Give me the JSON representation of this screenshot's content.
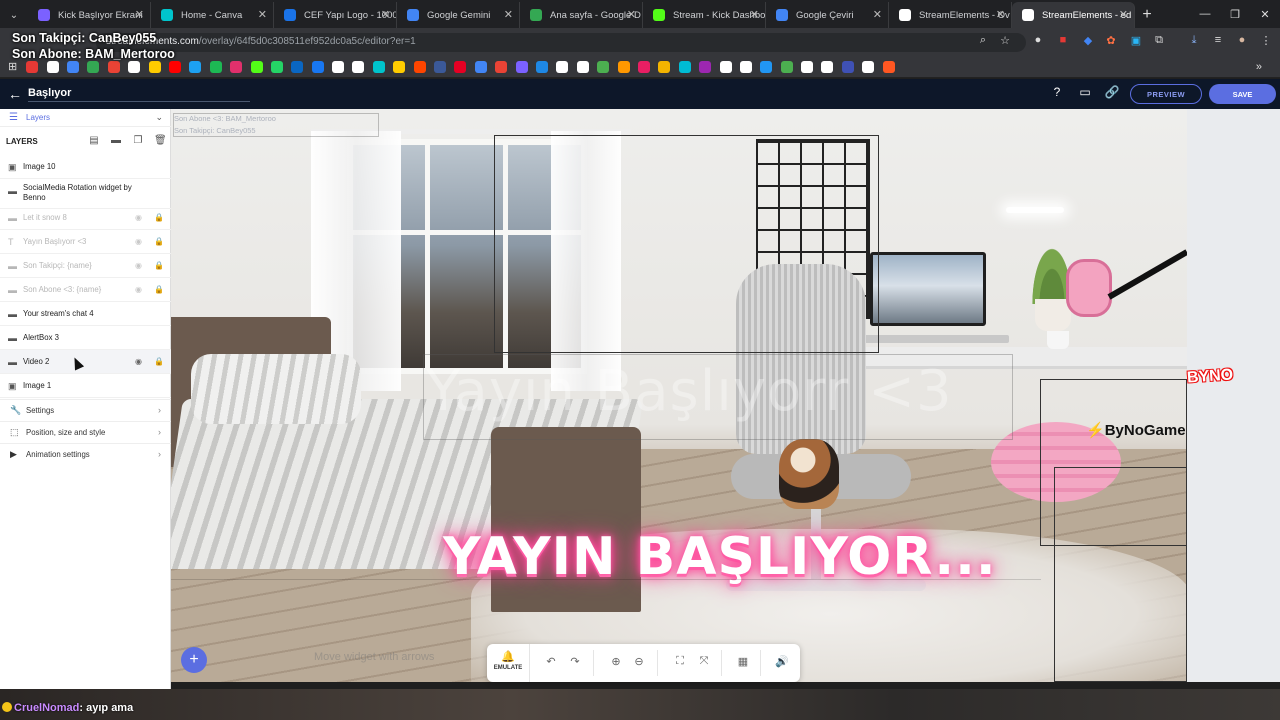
{
  "browser": {
    "tabs": [
      {
        "title": "Kick Başlıyor Ekranı",
        "color": "#7b61ff",
        "active": false
      },
      {
        "title": "Home - Canva",
        "color": "#00c4cc",
        "active": false
      },
      {
        "title": "CEF Yapı Logo - 1000",
        "color": "#1a73e8",
        "active": false
      },
      {
        "title": "Google Gemini",
        "color": "#4285f4",
        "active": false
      },
      {
        "title": "Ana sayfa - Google D",
        "color": "#34a853",
        "active": false
      },
      {
        "title": "Stream - Kick Dashbo",
        "color": "#53fc18",
        "active": false
      },
      {
        "title": "Google Çeviri",
        "color": "#4285f4",
        "active": false
      },
      {
        "title": "StreamElements - Ov",
        "color": "#ffffff",
        "active": false
      },
      {
        "title": "StreamElements - ed",
        "color": "#ffffff",
        "active": true
      }
    ],
    "url_host": "streamelements.com",
    "url_path": "/overlay/64f5d0c308511ef952dc0a5c/editor?er=1",
    "bookmark_colors": [
      "#e53935",
      "#ffffff",
      "#4285f4",
      "#34a853",
      "#ea4335",
      "#ffffff",
      "#ffcc00",
      "#ff0000",
      "#1da1f2",
      "#1db954",
      "#e1306c",
      "#53fc18",
      "#25d366",
      "#0a66c2",
      "#1877f2",
      "#ffffff",
      "#ffffff",
      "#00c4cc",
      "#ffcc00",
      "#ff4500",
      "#3b5998",
      "#e60023",
      "#4285f4",
      "#ea4335",
      "#7b61ff",
      "#1e88e5",
      "#ffffff",
      "#ffffff",
      "#4caf50",
      "#ff9800",
      "#e91e63",
      "#f4b400",
      "#00bcd4",
      "#9c27b0",
      "#ffffff",
      "#ffffff",
      "#2196f3",
      "#4caf50",
      "#ffffff",
      "#ffffff",
      "#3f51b5",
      "#ffffff",
      "#ff5722"
    ]
  },
  "overlay_text": {
    "last_follower": "Son Takipçi: CanBey055",
    "last_sub": "Son Abone: BAM_Mertoroo"
  },
  "header": {
    "title": "Başlıyor",
    "preview_label": "PREVIEW",
    "save_label": "SAVE"
  },
  "sidebar": {
    "tab_label": "Layers",
    "layers_heading": "LAYERS",
    "layers": [
      {
        "name": "Image 10",
        "dim": false
      },
      {
        "name": "SocialMedia Rotation widget by Benno",
        "dim": false
      },
      {
        "name": "Let it snow 8",
        "dim": true
      },
      {
        "name": "Yayın Başlıyorr <3",
        "dim": true
      },
      {
        "name": "Son Takipçi: {name}",
        "dim": true
      },
      {
        "name": "Son Abone <3: {name}",
        "dim": true
      },
      {
        "name": "Your stream's chat 4",
        "dim": false
      },
      {
        "name": "AlertBox 3",
        "dim": false
      },
      {
        "name": "Video 2",
        "dim": false
      },
      {
        "name": "Image 1",
        "dim": false
      }
    ],
    "sections": [
      "Settings",
      "Position, size and style",
      "Animation settings"
    ]
  },
  "canvas": {
    "tiny_layer_1": "Son Abone <3: BAM_Mertoroo",
    "tiny_layer_2": "Son Takipçi: CanBey055",
    "faint_title": "Yayın Başlıyorr <3",
    "main_title": "YAYIN BAŞLIYOR...",
    "brand": "ByNoGame",
    "corner_brand": "BYNO",
    "hint": "Move widget with arrows"
  },
  "toolbar": {
    "emulate_label": "EMULATE"
  },
  "chat": {
    "user": "CruelNomad",
    "message": ": ayıp ama"
  }
}
